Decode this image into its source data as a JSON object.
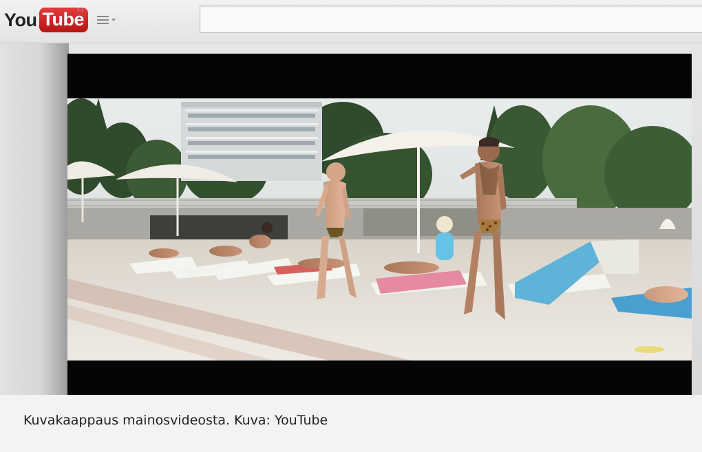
{
  "youtube": {
    "logo_you": "You",
    "logo_tube": "Tube",
    "region": "FI",
    "search": {
      "placeholder": ""
    }
  },
  "video": {
    "scene_icon": "video-frame-pool-scene"
  },
  "caption": {
    "text": "Kuvakaappaus mainosvideosta. Kuva: YouTube"
  },
  "colors": {
    "brand_red": "#cc1f1f",
    "caption_bg": "#f3f3f4"
  }
}
